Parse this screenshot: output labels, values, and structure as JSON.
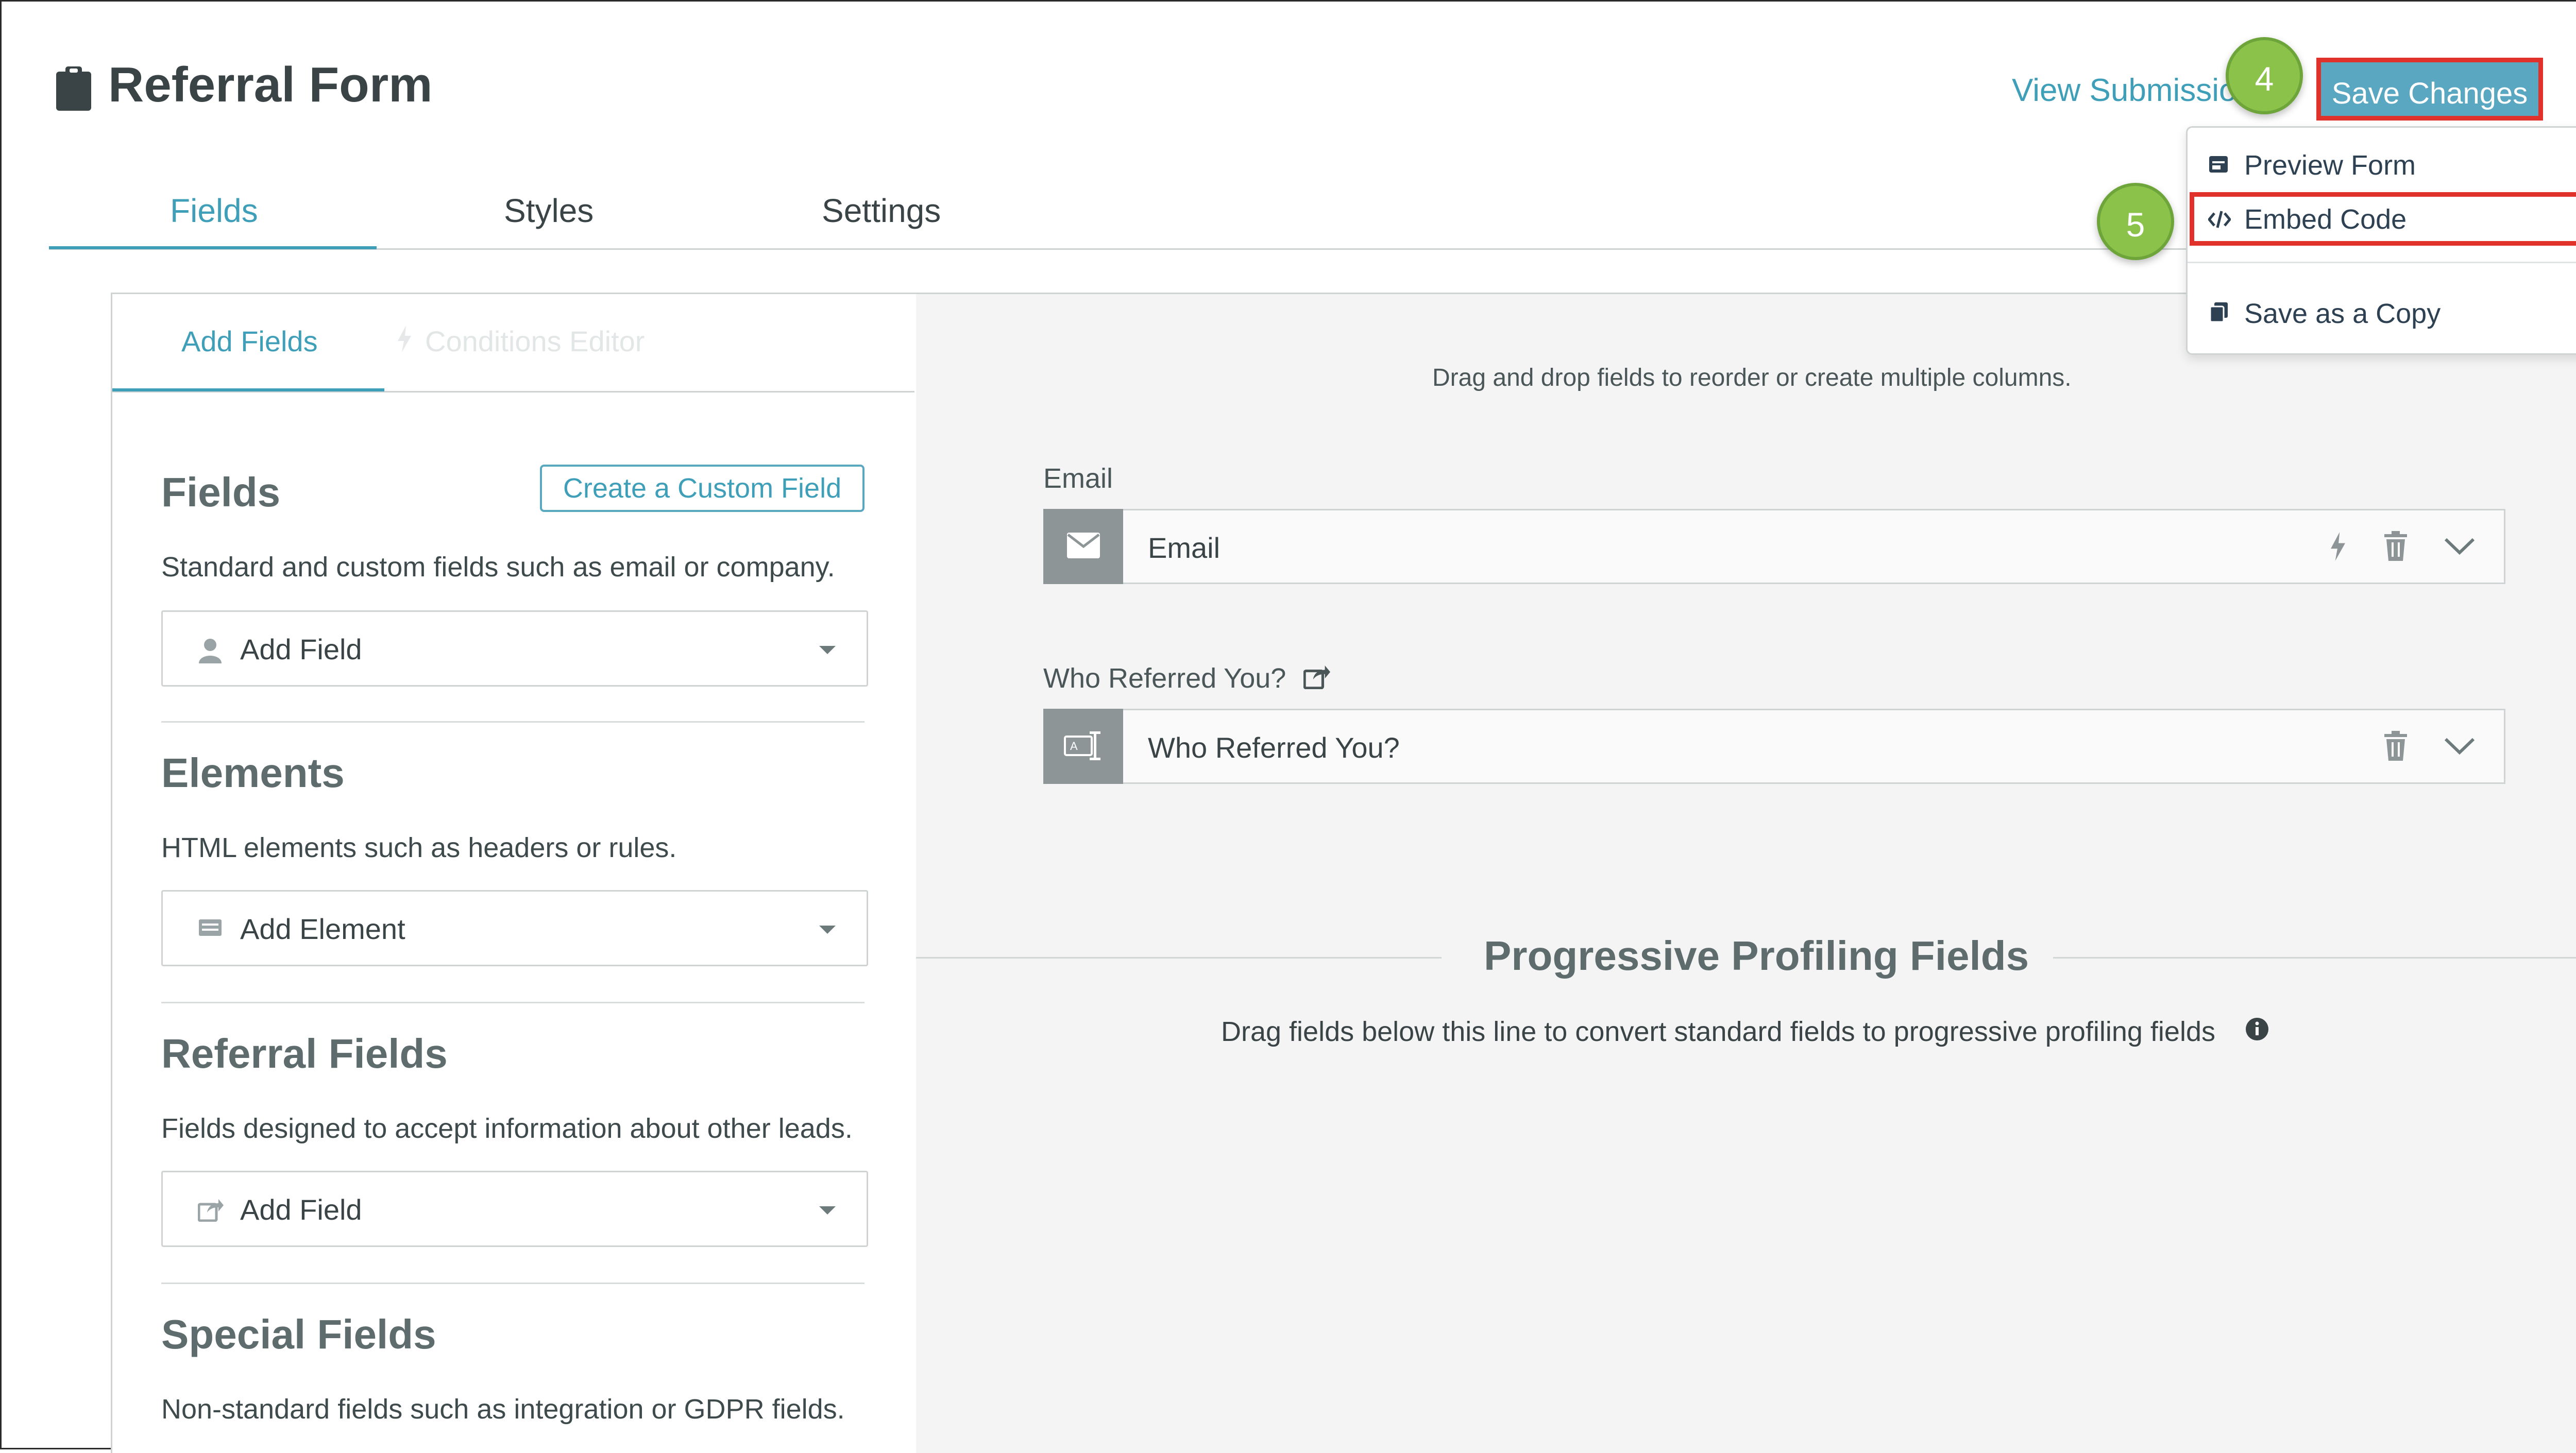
{
  "header": {
    "title": "Referral Form",
    "view_submissions": "View Submissio",
    "save_changes": "Save Changes"
  },
  "badges": {
    "step4": "4",
    "step5": "5"
  },
  "tabs": [
    {
      "label": "Fields",
      "active": true
    },
    {
      "label": "Styles",
      "active": false
    },
    {
      "label": "Settings",
      "active": false
    }
  ],
  "menu": {
    "items": [
      {
        "label": "Preview Form",
        "icon": "preview-icon"
      },
      {
        "label": "Embed Code",
        "icon": "code-icon"
      },
      {
        "label": "Save as a Copy",
        "icon": "copy-icon"
      }
    ]
  },
  "left_panel": {
    "sub_tabs": [
      {
        "label": "Add Fields",
        "active": true
      },
      {
        "label": "Conditions Editor",
        "active": false
      }
    ],
    "fields_section": {
      "heading": "Fields",
      "create_custom": "Create a Custom Field",
      "description": "Standard and custom fields such as email or company.",
      "select_label": "Add Field",
      "select_icon": "user-icon"
    },
    "elements_section": {
      "heading": "Elements",
      "description": "HTML elements such as headers or rules.",
      "select_label": "Add Element",
      "select_icon": "element-icon"
    },
    "referral_section": {
      "heading": "Referral Fields",
      "description": "Fields designed to accept information about other leads.",
      "select_label": "Add Field",
      "select_icon": "share-icon"
    },
    "special_section": {
      "heading": "Special Fields",
      "description": "Non-standard fields such as integration or GDPR fields."
    }
  },
  "canvas": {
    "hint": "Drag and drop fields to reorder or create multiple columns.",
    "fields": [
      {
        "label": "Email",
        "placeholder": "Email",
        "icon": "envelope-icon"
      },
      {
        "label": "Who Referred You?",
        "placeholder": "Who Referred You?",
        "icon": "text-field-icon"
      }
    ],
    "progressive": {
      "heading": "Progressive Profiling Fields",
      "description": "Drag fields below this line to convert standard fields to progressive profiling fields"
    }
  },
  "colors": {
    "accent": "#3f9fb9",
    "save_button": "#5aa7c2",
    "highlight": "#e0322b",
    "badge": "#8bc24a"
  }
}
